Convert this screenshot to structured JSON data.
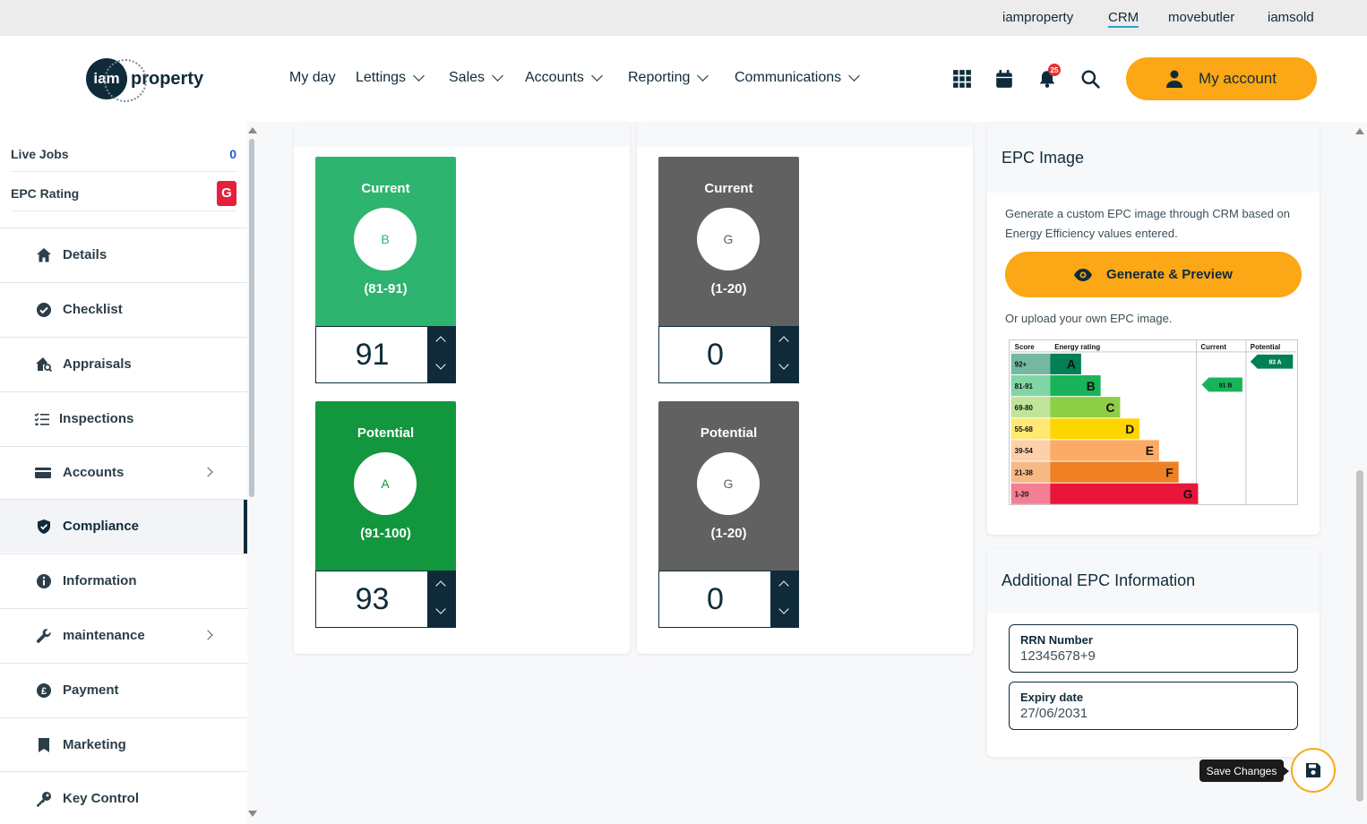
{
  "top_links": [
    "iamproperty",
    "CRM",
    "movebutler",
    "iamsold"
  ],
  "logo": {
    "circle_text": "iam",
    "word": "property"
  },
  "nav": [
    "My day",
    "Lettings",
    "Sales",
    "Accounts",
    "Reporting",
    "Communications"
  ],
  "notifications_count": "25",
  "my_account_label": "My account",
  "sidebar": {
    "stats": [
      {
        "label": "Live Jobs",
        "value": "0"
      },
      {
        "label": "EPC Rating",
        "value": "G"
      }
    ],
    "items": [
      {
        "label": "Details",
        "icon": "home-icon"
      },
      {
        "label": "Checklist",
        "icon": "check-circle-icon"
      },
      {
        "label": "Appraisals",
        "icon": "house-search-icon"
      },
      {
        "label": "Inspections",
        "icon": "list-check-icon"
      },
      {
        "label": "Accounts",
        "icon": "card-icon"
      },
      {
        "label": "Compliance",
        "icon": "shield-icon"
      },
      {
        "label": "Information",
        "icon": "info-icon"
      },
      {
        "label": "maintenance",
        "icon": "wrench-icon"
      },
      {
        "label": "Payment",
        "icon": "pound-icon"
      },
      {
        "label": "Marketing",
        "icon": "bookmark-icon"
      },
      {
        "label": "Key Control",
        "icon": "key-icon"
      }
    ]
  },
  "energy_efficiency": {
    "current": {
      "title": "Current",
      "band": "B",
      "range": "(81-91)",
      "value": "91"
    },
    "potential": {
      "title": "Potential",
      "band": "A",
      "range": "(91-100)",
      "value": "93"
    }
  },
  "environmental_impact": {
    "current": {
      "title": "Current",
      "band": "G",
      "range": "(1-20)",
      "value": "0"
    },
    "potential": {
      "title": "Potential",
      "band": "G",
      "range": "(1-20)",
      "value": "0"
    }
  },
  "epc_image": {
    "title": "EPC Image",
    "description": "Generate a custom EPC image through CRM based on Energy Efficiency values entered.",
    "generate_label": "Generate & Preview",
    "upload_text": "Or upload your own EPC image.",
    "chart": {
      "headers": [
        "Score",
        "Energy rating",
        "Current",
        "Potential"
      ],
      "bands": [
        {
          "score": "92+",
          "letter": "A",
          "color": "#008054"
        },
        {
          "score": "81-91",
          "letter": "B",
          "color": "#19b459"
        },
        {
          "score": "69-80",
          "letter": "C",
          "color": "#8dce46"
        },
        {
          "score": "55-68",
          "letter": "D",
          "color": "#ffd500"
        },
        {
          "score": "39-54",
          "letter": "E",
          "color": "#fcaa65"
        },
        {
          "score": "21-38",
          "letter": "F",
          "color": "#ef8023"
        },
        {
          "score": "1-20",
          "letter": "G",
          "color": "#e9153b"
        }
      ],
      "current_marker": "91 B",
      "potential_marker": "93 A"
    }
  },
  "additional": {
    "title": "Additional EPC Information",
    "rrn_label": "RRN Number",
    "rrn_value": "12345678+9",
    "expiry_label": "Expiry date",
    "expiry_value": "27/06/2031"
  },
  "save_tooltip": "Save Changes"
}
